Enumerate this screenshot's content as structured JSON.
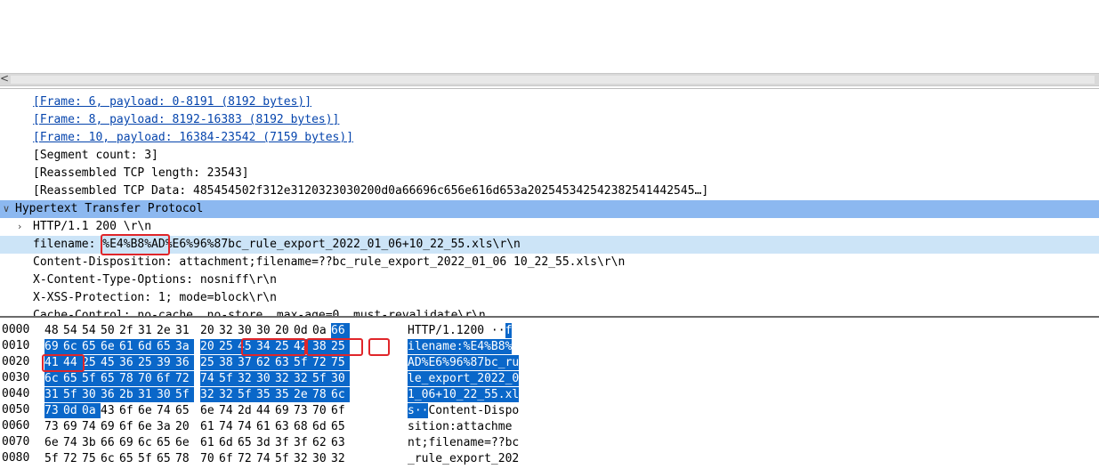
{
  "detail": {
    "rows": [
      {
        "text": "[Frame: 6, payload: 0-8191 (8192 bytes)]",
        "type": "link"
      },
      {
        "text": "[Frame: 8, payload: 8192-16383 (8192 bytes)]",
        "type": "link"
      },
      {
        "text": "[Frame: 10, payload: 16384-23542 (7159 bytes)]",
        "type": "link"
      },
      {
        "text": "[Segment count: 3]"
      },
      {
        "text": "[Reassembled TCP length: 23543]"
      },
      {
        "text": "[Reassembled TCP Data: 485454502f312e3120323030200d0a66696c656e616d653a202545342542382541442545…]"
      },
      {
        "text": "Hypertext Transfer Protocol"
      },
      {
        "text": "HTTP/1.1 200 \\r\\n"
      },
      {
        "text": "filename: %E4%B8%AD%E6%96%87bc_rule_export_2022_01_06+10_22_55.xls\\r\\n"
      },
      {
        "text": "Content-Disposition: attachment;filename=??bc_rule_export_2022_01_06 10_22_55.xls\\r\\n"
      },
      {
        "text": "X-Content-Type-Options: nosniff\\r\\n"
      },
      {
        "text": "X-XSS-Protection: 1; mode=block\\r\\n"
      },
      {
        "text": "Cache-Control: no-cache, no-store, max-age=0, must-revalidate\\r\\n"
      }
    ]
  },
  "bytes": {
    "rows": [
      {
        "offset": "0000",
        "hex": [
          "48",
          "54",
          "54",
          "50",
          "2f",
          "31",
          "2e",
          "31",
          "20",
          "32",
          "30",
          "30",
          "20",
          "0d",
          "0a",
          "66"
        ],
        "ascii": [
          "HTTP/1.1",
          " 200 ··",
          "f"
        ]
      },
      {
        "offset": "0010",
        "hex": [
          "69",
          "6c",
          "65",
          "6e",
          "61",
          "6d",
          "65",
          "3a",
          "20",
          "25",
          "45",
          "34",
          "25",
          "42",
          "38",
          "25"
        ],
        "ascii": [
          "ilename:",
          " %E4%B8%"
        ]
      },
      {
        "offset": "0020",
        "hex": [
          "41",
          "44",
          "25",
          "45",
          "36",
          "25",
          "39",
          "36",
          "25",
          "38",
          "37",
          "62",
          "63",
          "5f",
          "72",
          "75"
        ],
        "ascii": [
          "AD%E6%96",
          " %87bc_ru"
        ]
      },
      {
        "offset": "0030",
        "hex": [
          "6c",
          "65",
          "5f",
          "65",
          "78",
          "70",
          "6f",
          "72",
          "74",
          "5f",
          "32",
          "30",
          "32",
          "32",
          "5f",
          "30"
        ],
        "ascii": [
          "le_expor",
          " t_2022_0"
        ]
      },
      {
        "offset": "0040",
        "hex": [
          "31",
          "5f",
          "30",
          "36",
          "2b",
          "31",
          "30",
          "5f",
          "32",
          "32",
          "5f",
          "35",
          "35",
          "2e",
          "78",
          "6c"
        ],
        "ascii": [
          "1_06+10_",
          " 22_55.xl"
        ]
      },
      {
        "offset": "0050",
        "hex": [
          "73",
          "0d",
          "0a",
          "43",
          "6f",
          "6e",
          "74",
          "65",
          "6e",
          "74",
          "2d",
          "44",
          "69",
          "73",
          "70",
          "6f"
        ],
        "ascii": [
          "s··",
          "Conte",
          " nt-Dispo"
        ]
      },
      {
        "offset": "0060",
        "hex": [
          "73",
          "69",
          "74",
          "69",
          "6f",
          "6e",
          "3a",
          "20",
          "61",
          "74",
          "74",
          "61",
          "63",
          "68",
          "6d",
          "65"
        ],
        "ascii": [
          "sition: ",
          " attachme"
        ]
      },
      {
        "offset": "0070",
        "hex": [
          "6e",
          "74",
          "3b",
          "66",
          "69",
          "6c",
          "65",
          "6e",
          "61",
          "6d",
          "65",
          "3d",
          "3f",
          "3f",
          "62",
          "63"
        ],
        "ascii": [
          "nt;filen",
          " ame=??bc"
        ]
      },
      {
        "offset": "0080",
        "hex": [
          "5f",
          "72",
          "75",
          "6c",
          "65",
          "5f",
          "65",
          "78",
          "70",
          "6f",
          "72",
          "74",
          "5f",
          "32",
          "30",
          "32"
        ],
        "ascii": [
          "_rule_ex",
          " port_202"
        ]
      }
    ]
  },
  "colors": {
    "selection_dark": "#8cb8f0",
    "selection_light": "#cce4f7",
    "byte_highlight": "#0a67c9",
    "annotation_red": "#e0262a",
    "link": "#0645ad"
  },
  "icons": {
    "scroll_left": "chevron-left-icon",
    "expander_open": "chevron-down-icon",
    "expander_closed": "chevron-right-icon"
  }
}
